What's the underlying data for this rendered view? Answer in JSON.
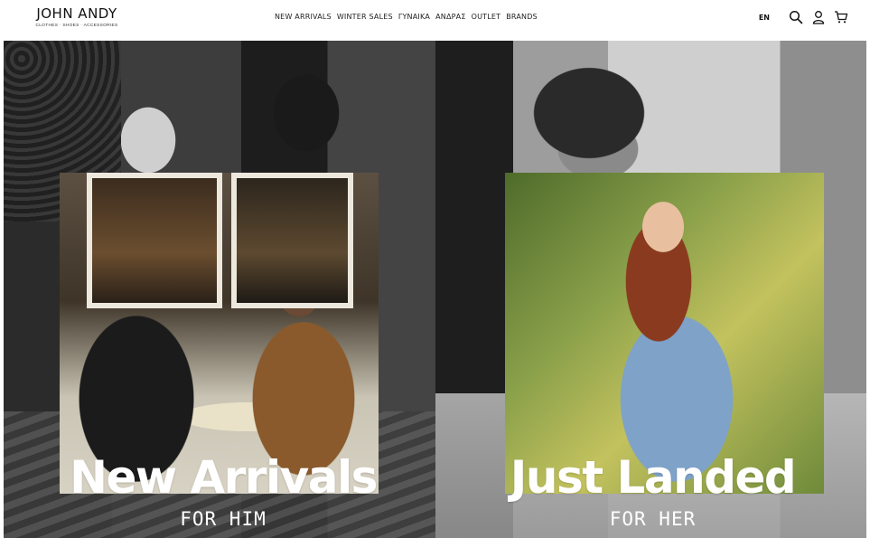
{
  "header": {
    "logo": {
      "name": "JOHN ANDY",
      "tagline": "CLOTHES · SHOES · ACCESSORIES"
    },
    "nav": [
      {
        "label": "NEW ARRIVALS"
      },
      {
        "label": "WINTER SALES"
      },
      {
        "label": "ΓΥΝΑΙΚΑ"
      },
      {
        "label": "ΑΝΔΡΑΣ"
      },
      {
        "label": "OUTLET"
      },
      {
        "label": "BRANDS"
      }
    ],
    "language": "EN",
    "icons": [
      "search-icon",
      "user-icon",
      "cart-icon"
    ]
  },
  "hero": {
    "left": {
      "title": "New Arrivals",
      "subtitle": "FOR HIM"
    },
    "right": {
      "title": "Just Landed",
      "subtitle": "FOR HER"
    }
  },
  "colors": {
    "background": "#ffffff",
    "text": "#111111",
    "hero_text": "#ffffff"
  }
}
